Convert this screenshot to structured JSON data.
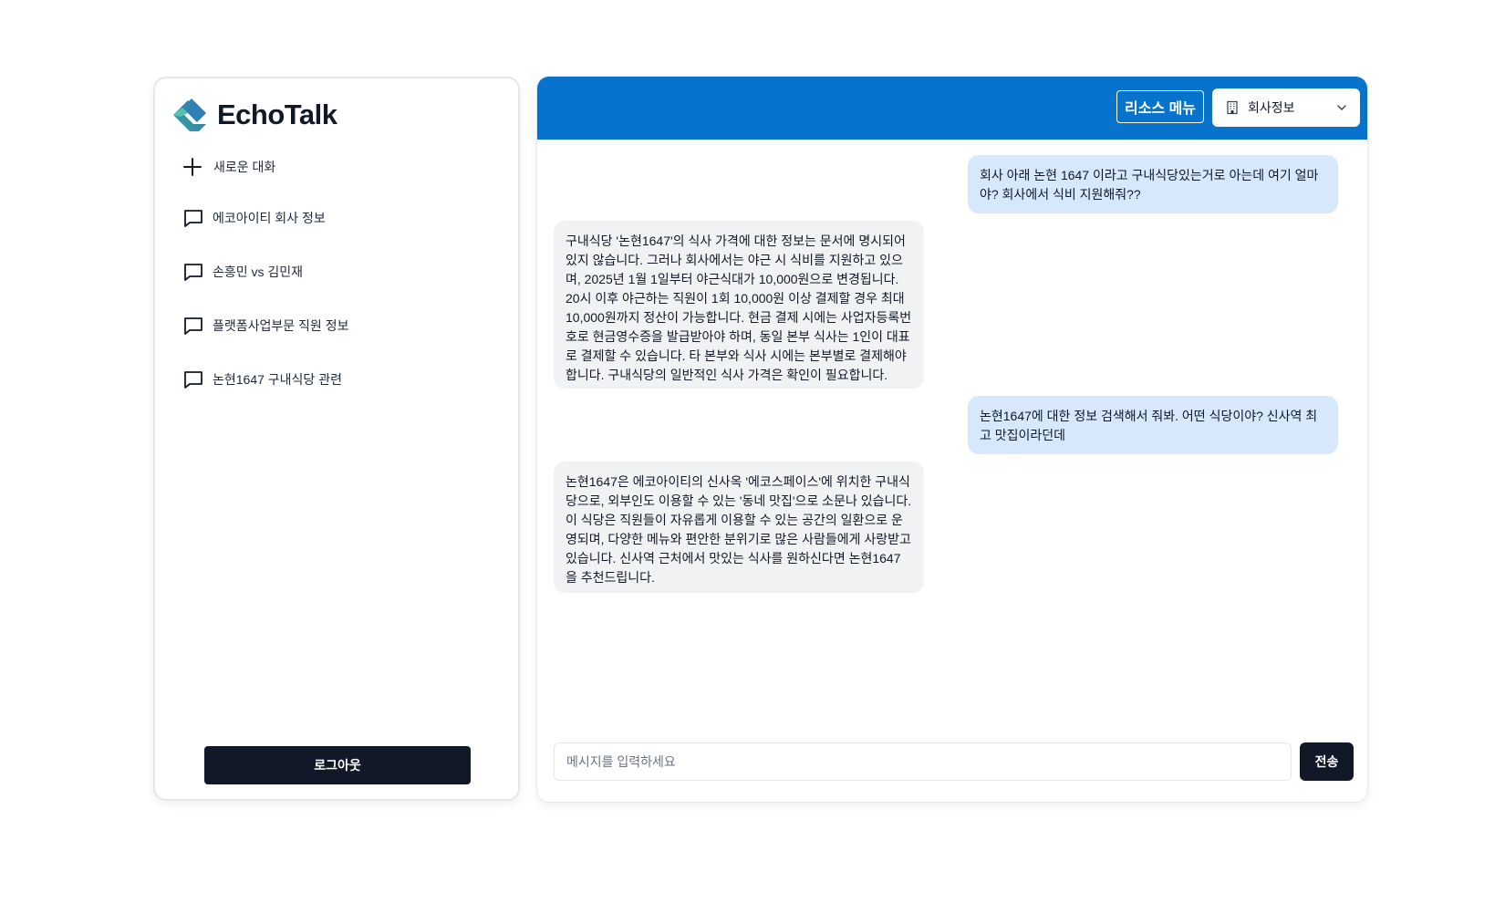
{
  "app": {
    "name": "EchoTalk"
  },
  "sidebar": {
    "new_chat_label": "새로운 대화",
    "items": [
      {
        "label": "에코아이티 회사 정보"
      },
      {
        "label": "손흥민 vs 김민재"
      },
      {
        "label": "플랫폼사업부문 직원 정보"
      },
      {
        "label": "논현1647 구내식당 관련"
      }
    ],
    "logout_label": "로그아웃"
  },
  "header": {
    "resource_button": "리소스 메뉴",
    "select_value": "회사정보",
    "bg_color": "#0873cc"
  },
  "messages": [
    {
      "role": "user",
      "text": "회사 아래 논현 1647 이라고 구내식당있는거로 아는데 여기 얼마야? 회사에서 식비 지원해줘??"
    },
    {
      "role": "bot",
      "text": "구내식당 '논현1647'의 식사 가격에 대한 정보는 문서에 명시되어 있지 않습니다. 그러나 회사에서는 야근 시 식비를 지원하고 있으며, 2025년 1월 1일부터 야근식대가 10,000원으로 변경됩니다. 20시 이후 야근하는 직원이 1회 10,000원 이상 결제할 경우 최대 10,000원까지 정산이 가능합니다. 현금 결제 시에는 사업자등록번호로 현금영수증을 발급받아야 하며, 동일 본부 식사는 1인이 대표로 결제할 수 있습니다. 타 본부와 식사 시에는 본부별로 결제해야 합니다. 구내식당의 일반적인 식사 가격은 확인이 필요합니다."
    },
    {
      "role": "user",
      "text": "논현1647에 대한 정보 검색해서 줘봐. 어떤 식당이야? 신사역 최고 맛집이라던데"
    },
    {
      "role": "bot",
      "text": "논현1647은 에코아이티의 신사옥 '에코스페이스'에 위치한 구내식당으로, 외부인도 이용할 수 있는 '동네 맛집'으로 소문나 있습니다. 이 식당은 직원들이 자유롭게 이용할 수 있는 공간의 일환으로 운영되며, 다양한 메뉴와 편안한 분위기로 많은 사람들에게 사랑받고 있습니다. 신사역 근처에서 맛있는 식사를 원하신다면 논현1647을 추천드립니다."
    }
  ],
  "composer": {
    "placeholder": "메시지를 입력하세요",
    "value": "",
    "send_label": "전송"
  }
}
